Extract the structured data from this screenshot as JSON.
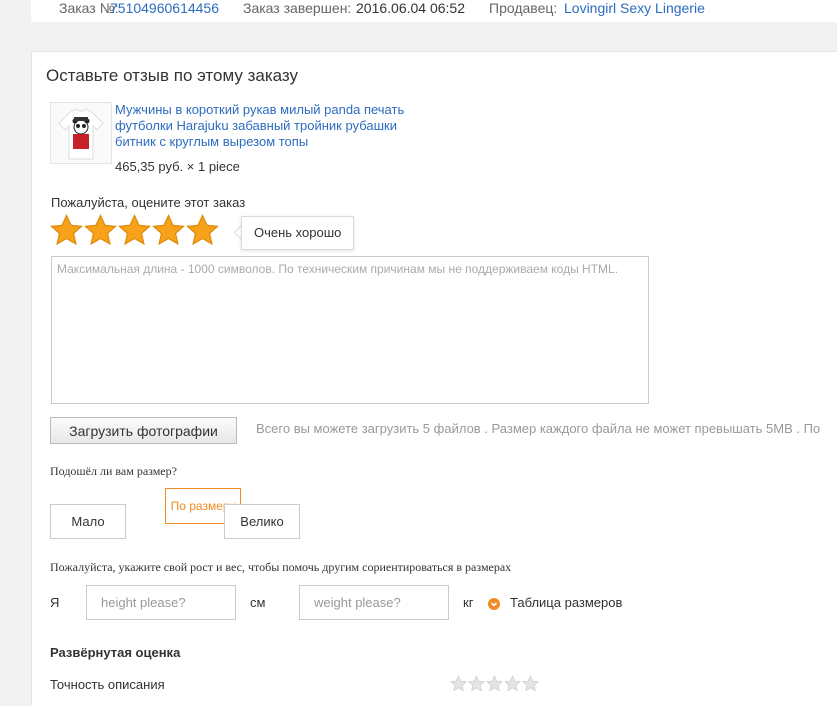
{
  "order_bar": {
    "order_label": "Заказ №:",
    "order_number": "75104960614456",
    "completed_label": "Заказ завершен:",
    "completed_date": "2016.06.04 06:52",
    "seller_label": "Продавец:",
    "seller_name": "Lovingirl Sexy Lingerie"
  },
  "review": {
    "title": "Оставьте отзыв по этому заказу",
    "product": {
      "title": "Мужчины в короткий рукав милый panda печать футболки Harajuku забавный тройник рубашки битник с круглым вырезом топы",
      "price": "465,35 руб. × 1 piece"
    },
    "rating_label": "Пожалуйста, оцените этот заказ",
    "rating": {
      "value": 5,
      "max": 5,
      "tooltip": "Очень хорошо"
    },
    "textarea_placeholder": "Максимальная длина - 1000 символов. По техническим причинам мы не поддерживаем коды HTML.",
    "upload_button": "Загрузить фотографии",
    "upload_note": "Всего вы можете загрузить 5 файлов . Размер каждого файла не может превышать 5MB . По",
    "fit": {
      "question": "Подошёл ли вам размер?",
      "options": [
        "Мало",
        "По размеру",
        "Велико"
      ],
      "selected": "По размеру"
    },
    "measurements": {
      "note": "Пожалуйста, укажите свой рост и вес, чтобы помочь другим сориентироваться в размерах",
      "i_label": "Я",
      "height_placeholder": "height please?",
      "height_unit": "см",
      "weight_placeholder": "weight please?",
      "weight_unit": "кг",
      "size_table_link": "Таблица размеров"
    },
    "detailed": {
      "title": "Развёрнутая оценка",
      "accuracy_label": "Точность описания",
      "accuracy_rating": 0
    }
  },
  "colors": {
    "accent": "#f08a24",
    "link": "#2d6cc0",
    "star_on": "#f7a21a",
    "star_off": "#c9c9c9"
  }
}
